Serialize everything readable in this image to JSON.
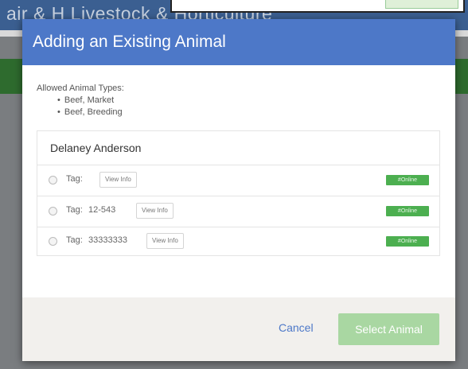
{
  "background": {
    "page_title": "air & H Livestock & Horticulture"
  },
  "modal": {
    "title": "Adding an Existing Animal",
    "allowed_label": "Allowed Animal Types:",
    "allowed_types": [
      "Beef, Market",
      "Beef, Breeding"
    ],
    "owner": "Delaney Anderson",
    "animals": [
      {
        "tag_label": "Tag:",
        "tag_value": "",
        "view_label": "View Info",
        "status": "#Online"
      },
      {
        "tag_label": "Tag:",
        "tag_value": "12-543",
        "view_label": "View Info",
        "status": "#Online"
      },
      {
        "tag_label": "Tag:",
        "tag_value": "33333333",
        "view_label": "View Info",
        "status": "#Online"
      }
    ],
    "cancel_label": "Cancel",
    "select_label": "Select Animal"
  },
  "colors": {
    "header": "#4d78c8",
    "badge": "#4caf50",
    "select_button": "#a9d7a2"
  }
}
